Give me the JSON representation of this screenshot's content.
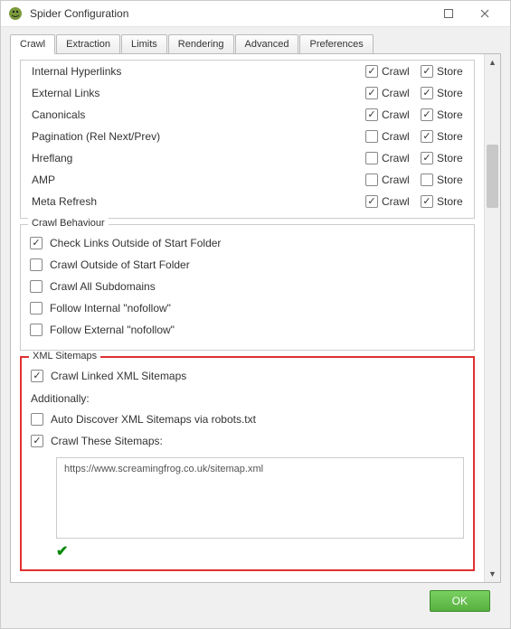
{
  "window": {
    "title": "Spider Configuration"
  },
  "tabs": [
    "Crawl",
    "Extraction",
    "Limits",
    "Rendering",
    "Advanced",
    "Preferences"
  ],
  "col_labels": {
    "crawl": "Crawl",
    "store": "Store"
  },
  "link_rows": [
    {
      "label": "Internal Hyperlinks",
      "crawl": true,
      "store": true
    },
    {
      "label": "External Links",
      "crawl": true,
      "store": true
    },
    {
      "label": "Canonicals",
      "crawl": true,
      "store": true
    },
    {
      "label": "Pagination (Rel Next/Prev)",
      "crawl": false,
      "store": true
    },
    {
      "label": "Hreflang",
      "crawl": false,
      "store": true
    },
    {
      "label": "AMP",
      "crawl": false,
      "store": false
    },
    {
      "label": "Meta Refresh",
      "crawl": true,
      "store": true
    }
  ],
  "behaviour": {
    "title": "Crawl Behaviour",
    "opts": [
      {
        "label": "Check Links Outside of Start Folder",
        "checked": true
      },
      {
        "label": "Crawl Outside of Start Folder",
        "checked": false
      },
      {
        "label": "Crawl All Subdomains",
        "checked": false
      },
      {
        "label": "Follow Internal \"nofollow\"",
        "checked": false
      },
      {
        "label": "Follow External \"nofollow\"",
        "checked": false
      }
    ]
  },
  "sitemaps": {
    "title": "XML Sitemaps",
    "crawl_linked": {
      "label": "Crawl Linked XML Sitemaps",
      "checked": true
    },
    "additionally": "Additionally:",
    "auto_discover": {
      "label": "Auto Discover XML Sitemaps via robots.txt",
      "checked": false
    },
    "crawl_these": {
      "label": "Crawl These Sitemaps:",
      "checked": true
    },
    "text": "https://www.screamingfrog.co.uk/sitemap.xml"
  },
  "footer": {
    "ok": "OK"
  }
}
